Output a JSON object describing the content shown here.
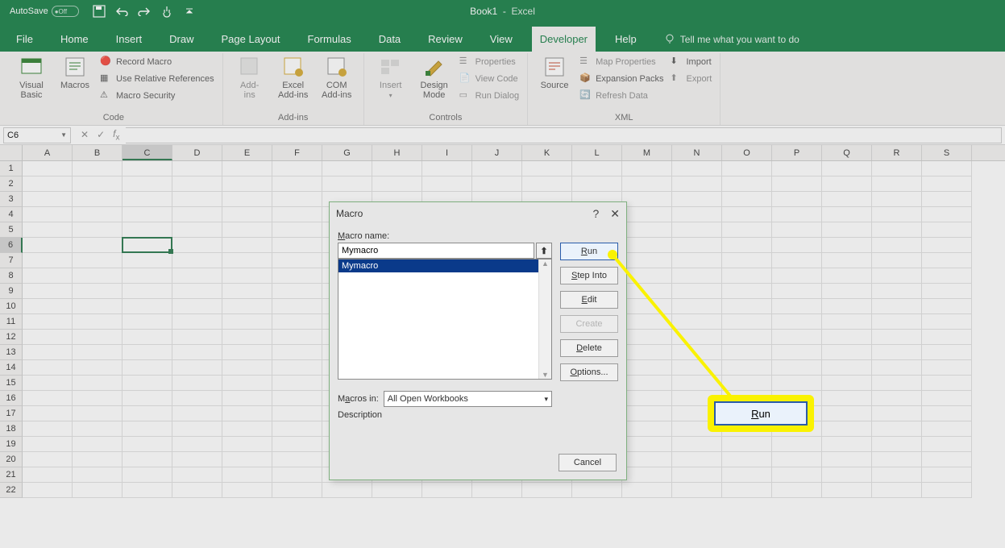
{
  "titlebar": {
    "autosave_label": "AutoSave",
    "autosave_state": "Off",
    "book": "Book1",
    "app": "Excel"
  },
  "tabs": {
    "items": [
      "File",
      "Home",
      "Insert",
      "Draw",
      "Page Layout",
      "Formulas",
      "Data",
      "Review",
      "View",
      "Developer",
      "Help"
    ],
    "active_index": 9,
    "tellme_placeholder": "Tell me what you want to do"
  },
  "ribbon": {
    "code": {
      "visual_basic": "Visual\nBasic",
      "macros": "Macros",
      "record_macro": "Record Macro",
      "use_relative": "Use Relative References",
      "macro_security": "Macro Security",
      "label": "Code"
    },
    "addins": {
      "addins": "Add-\nins",
      "excel_addins": "Excel\nAdd-ins",
      "com_addins": "COM\nAdd-ins",
      "label": "Add-ins"
    },
    "controls": {
      "insert": "Insert",
      "design_mode": "Design\nMode",
      "properties": "Properties",
      "view_code": "View Code",
      "run_dialog": "Run Dialog",
      "label": "Controls"
    },
    "xml": {
      "source": "Source",
      "map_properties": "Map Properties",
      "expansion_packs": "Expansion Packs",
      "refresh_data": "Refresh Data",
      "import": "Import",
      "export": "Export",
      "label": "XML"
    }
  },
  "formula_bar": {
    "cell_ref": "C6"
  },
  "grid": {
    "columns": [
      "A",
      "B",
      "C",
      "D",
      "E",
      "F",
      "G",
      "H",
      "I",
      "J",
      "K",
      "L",
      "M",
      "N",
      "O",
      "P",
      "Q",
      "R",
      "S"
    ],
    "rows": [
      "1",
      "2",
      "3",
      "4",
      "5",
      "6",
      "7",
      "8",
      "9",
      "10",
      "11",
      "12",
      "13",
      "14",
      "15",
      "16",
      "17",
      "18",
      "19",
      "20",
      "21",
      "22"
    ],
    "active_col_index": 2,
    "active_row_index": 5
  },
  "dialog": {
    "title": "Macro",
    "macro_name_label": "Macro name:",
    "macro_name_value": "Mymacro",
    "list_items": [
      "Mymacro"
    ],
    "macros_in_label": "Macros in:",
    "macros_in_value": "All Open Workbooks",
    "description_label": "Description",
    "buttons": {
      "run": "Run",
      "step_into": "Step Into",
      "edit": "Edit",
      "create": "Create",
      "delete": "Delete",
      "options": "Options...",
      "cancel": "Cancel"
    }
  },
  "callout": {
    "label": "Run"
  }
}
